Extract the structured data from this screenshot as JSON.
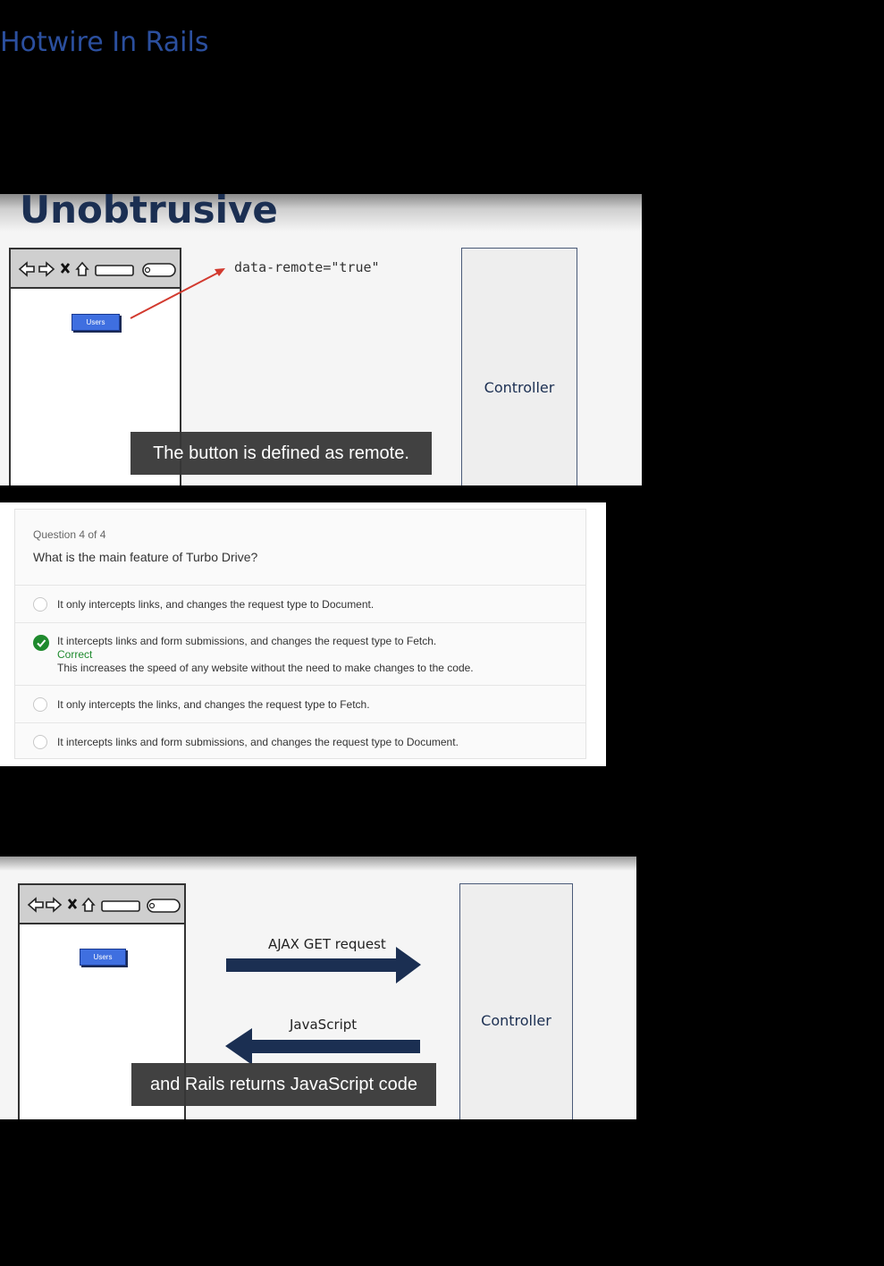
{
  "page": {
    "title": "Hotwire In Rails"
  },
  "slide1": {
    "heading": "Unobtrusive",
    "button_label": "Users",
    "code_label": "data-remote=\"true\"",
    "controller_label": "Controller",
    "caption": "The button is defined as remote."
  },
  "quiz": {
    "counter": "Question 4 of 4",
    "question": "What is the main feature of Turbo Drive?",
    "options": [
      {
        "text": "It only intercepts links, and changes the request type to Document.",
        "selected": false
      },
      {
        "text": "It intercepts links and form submissions, and changes the request type to Fetch.",
        "selected": true,
        "status": "Correct",
        "explanation": "This increases the speed of any website without the need to make changes to the code."
      },
      {
        "text": "It only intercepts the links, and changes the request type to Fetch.",
        "selected": false
      },
      {
        "text": "It intercepts links and form submissions, and changes the request type to Document.",
        "selected": false
      }
    ]
  },
  "slide2": {
    "button_label": "Users",
    "request_label": "AJAX GET request",
    "response_label": "JavaScript",
    "controller_label": "Controller",
    "caption": "and Rails returns JavaScript code"
  },
  "colors": {
    "title": "#2b4f9e",
    "heading": "#1b2f52",
    "arrow_red": "#d23a2f",
    "arrow_navy": "#1b2f52",
    "correct_green": "#1f8a2e",
    "button_blue": "#3f6fe0"
  },
  "icons": [
    "back-arrow-icon",
    "forward-arrow-icon",
    "close-icon",
    "home-icon",
    "address-bar",
    "search-icon",
    "check-circle-icon"
  ]
}
